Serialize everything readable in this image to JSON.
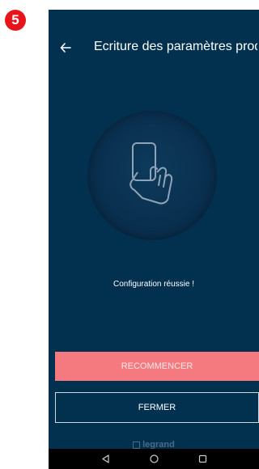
{
  "step": {
    "number": "5"
  },
  "header": {
    "title": "Ecriture des paramètres prod..."
  },
  "status": {
    "message": "Configuration réussie !"
  },
  "actions": {
    "restart_label": "RECOMMENCER",
    "close_label": "FERMER"
  },
  "brand": {
    "name": "legrand"
  },
  "colors": {
    "background": "#023150",
    "primary_button": "#f47a80",
    "badge": "#e8141b"
  },
  "icons": {
    "back": "arrow-left-icon",
    "illustration": "hand-holding-phone-icon",
    "nav": [
      "back-triangle-icon",
      "home-circle-icon",
      "recents-square-icon"
    ]
  }
}
